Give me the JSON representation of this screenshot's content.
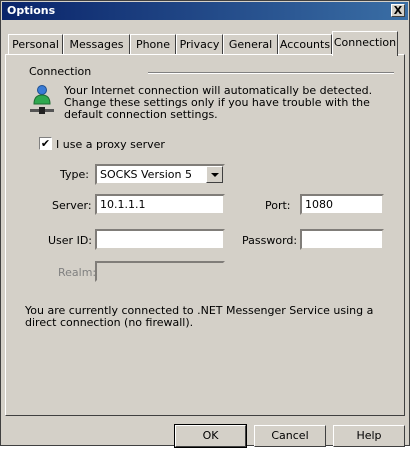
{
  "window": {
    "title": "Options",
    "close_glyph": "X"
  },
  "tabs": [
    {
      "label": "Personal"
    },
    {
      "label": "Messages"
    },
    {
      "label": "Phone"
    },
    {
      "label": "Privacy"
    },
    {
      "label": "General"
    },
    {
      "label": "Accounts"
    },
    {
      "label": "Connection"
    }
  ],
  "active_tab": "Connection",
  "connection": {
    "group_label": "Connection",
    "info_text": "Your Internet connection will automatically be detected.  Change these settings only if you have trouble with the default connection settings.",
    "icon": "network-connection-icon",
    "proxy_checkbox": {
      "label": "I use a proxy server",
      "checked": true,
      "mark": "✔"
    },
    "type": {
      "label": "Type:",
      "value": "SOCKS Version 5"
    },
    "server": {
      "label": "Server:",
      "value": "10.1.1.1"
    },
    "port": {
      "label": "Port:",
      "value": "1080"
    },
    "user_id": {
      "label": "User ID:",
      "value": ""
    },
    "password": {
      "label": "Password:",
      "value": ""
    },
    "realm": {
      "label": "Realm:",
      "value": "",
      "disabled": true
    },
    "status_text": "You are currently connected to .NET Messenger Service using a direct connection (no firewall)."
  },
  "buttons": {
    "ok": "OK",
    "cancel": "Cancel",
    "help": "Help"
  }
}
